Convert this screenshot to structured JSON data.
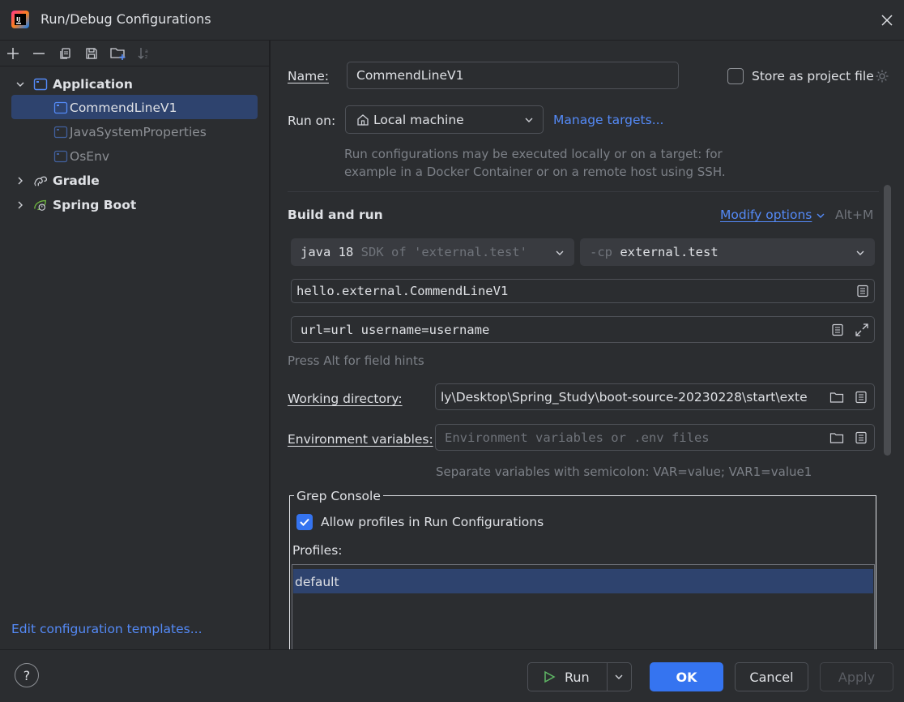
{
  "window": {
    "title": "Run/Debug Configurations"
  },
  "tree": {
    "application": "Application",
    "items": [
      "CommendLineV1",
      "JavaSystemProperties",
      "OsEnv"
    ],
    "gradle": "Gradle",
    "spring_boot": "Spring Boot"
  },
  "edit_templates": "Edit configuration templates...",
  "form": {
    "name_label": "Name:",
    "name_value": "CommendLineV1",
    "store_label": "Store as project file",
    "run_on_label": "Run on:",
    "run_on_value": "Local machine",
    "manage_targets": "Manage targets...",
    "run_on_hint_1": "Run configurations may be executed locally or on a target: for",
    "run_on_hint_2": "example in a Docker Container or on a remote host using SSH.",
    "build_and_run": "Build and run",
    "modify_options": "Modify options",
    "modify_shortcut": "Alt+M",
    "sdk_main": "java 18",
    "sdk_sub": "SDK of 'external.test'",
    "cp_prefix": "-cp",
    "cp_value": "external.test",
    "main_class": "hello.external.CommendLineV1",
    "program_args": "url=url username=username",
    "field_hints": "Press Alt for field hints",
    "workdir_label": "Working directory:",
    "workdir_value": "ly\\Desktop\\Spring_Study\\boot-source-20230228\\start\\exte",
    "env_label": "Environment variables:",
    "env_placeholder": "Environment variables or .env files",
    "env_hint": "Separate variables with semicolon: VAR=value; VAR1=value1",
    "grep_console": "Grep Console",
    "allow_profiles": "Allow profiles in Run Configurations",
    "allow_profiles_checked": true,
    "profiles_label": "Profiles:",
    "profiles": [
      "default"
    ]
  },
  "buttons": {
    "help": "?",
    "run": "Run",
    "ok": "OK",
    "cancel": "Cancel",
    "apply": "Apply"
  },
  "colors": {
    "accent": "#3574f0",
    "link": "#548af7",
    "selection": "#2e436e",
    "spring_green": "#6db33f"
  }
}
